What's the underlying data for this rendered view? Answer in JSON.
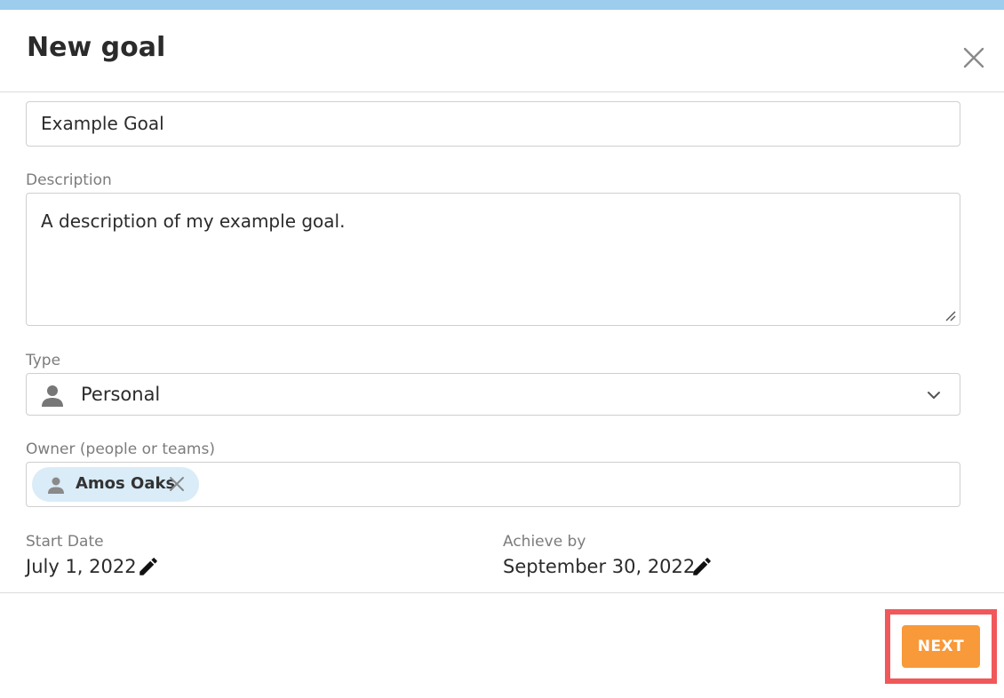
{
  "colors": {
    "top_bar": "#9ccdec",
    "accent": "#f8993a",
    "chip_bg": "#d9ecf8",
    "highlight": "#f0585a"
  },
  "dialog": {
    "title": "New goal",
    "close_icon": "close-icon"
  },
  "form": {
    "name_value": "Example Goal",
    "description_label": "Description",
    "description_value": "A description of my example goal.",
    "type_label": "Type",
    "type_value": "Personal",
    "type_icon": "person-icon",
    "owner_label": "Owner (people or teams)",
    "owner_chip": {
      "label": "Amos Oaks",
      "icon": "person-icon",
      "remove_icon": "close-icon"
    },
    "start_date_label": "Start Date",
    "start_date_value": "July 1, 2022",
    "achieve_by_label": "Achieve by",
    "achieve_by_value": "September 30, 2022",
    "edit_icon": "pencil-icon"
  },
  "footer": {
    "next_label": "NEXT"
  }
}
